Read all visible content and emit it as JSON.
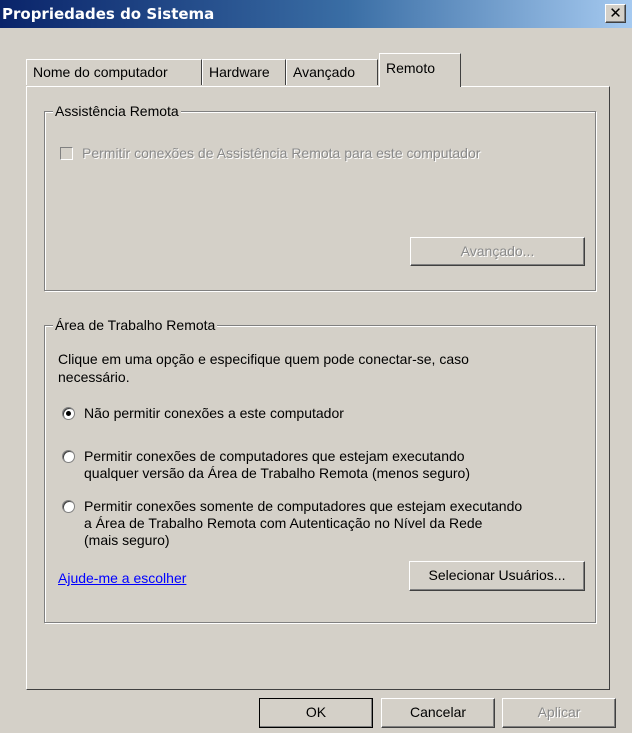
{
  "window": {
    "title": "Propriedades do Sistema",
    "close_glyph": "✕"
  },
  "tabs": [
    {
      "label": "Nome do computador",
      "active": false
    },
    {
      "label": "Hardware",
      "active": false
    },
    {
      "label": "Avançado",
      "active": false
    },
    {
      "label": "Remoto",
      "active": true
    }
  ],
  "remote_assistance": {
    "title": "Assistência Remota",
    "checkbox_label": "Permitir conexões de Assistência Remota para este computador",
    "checked": false,
    "advanced_button": "Avançado..."
  },
  "remote_desktop": {
    "title": "Área de Trabalho Remota",
    "description_line1": "Clique em uma opção e especifique quem pode conectar-se, caso",
    "description_line2": "necessário.",
    "options": [
      {
        "lines": [
          "Não permitir conexões a este computador"
        ],
        "selected": true
      },
      {
        "lines": [
          "Permitir conexões de computadores que estejam executando",
          "qualquer versão da Área de Trabalho Remota (menos seguro)"
        ],
        "selected": false
      },
      {
        "lines": [
          "Permitir conexões somente de computadores que estejam executando",
          "a Área de Trabalho Remota com Autenticação no Nível da Rede",
          "(mais seguro)"
        ],
        "selected": false
      }
    ],
    "help_link": "Ajude-me a escolher",
    "select_users_button": "Selecionar Usuários..."
  },
  "footer": {
    "ok": "OK",
    "cancel": "Cancelar",
    "apply": "Aplicar"
  }
}
